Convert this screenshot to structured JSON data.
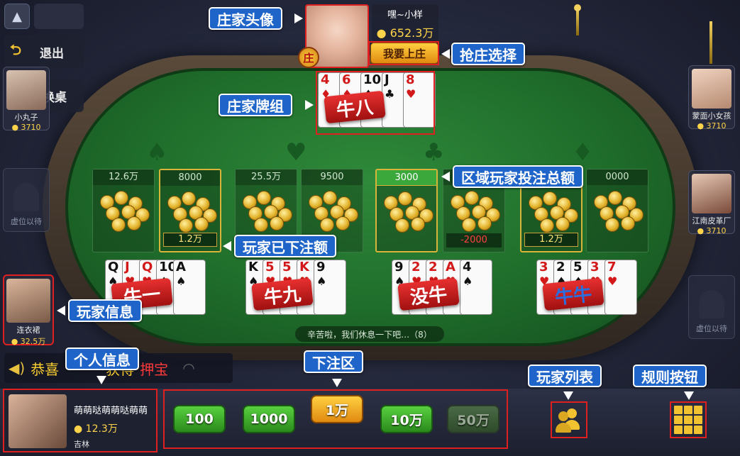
{
  "controls": {
    "collapse_icon": "triangle-up",
    "exit_label": "退出",
    "switch_label": "换桌"
  },
  "banker": {
    "name": "嘿~小样",
    "gold": "652.3万",
    "badge": "庄",
    "grab_button": "我要上庄",
    "hand": [
      {
        "rank": "4",
        "suit": "♦",
        "color": "red"
      },
      {
        "rank": "6",
        "suit": "♦",
        "color": "red"
      },
      {
        "rank": "10",
        "suit": "♠",
        "color": "blk"
      },
      {
        "rank": "J",
        "suit": "♣",
        "color": "blk"
      },
      {
        "rank": "8",
        "suit": "♥",
        "color": "red"
      }
    ],
    "result": "牛八"
  },
  "seats": {
    "left_top": {
      "name": "小丸子",
      "gold": "3710"
    },
    "left_mid": {
      "label": "虚位以待"
    },
    "left_bottom": {
      "name": "连衣裙",
      "gold": "32.5万"
    },
    "right_top": {
      "name": "蒙面小女孩",
      "gold": "3710"
    },
    "right_mid": {
      "name": "江南皮革厂",
      "gold": "3710"
    },
    "right_bottom": {
      "label": "虚位以待"
    }
  },
  "zones": [
    {
      "total": "12.6万",
      "mine": ""
    },
    {
      "total": "8000",
      "mine": "1.2万"
    },
    {
      "total": "25.5万",
      "mine": ""
    },
    {
      "total": "9500",
      "mine": ""
    },
    {
      "total": "3000",
      "mine": ""
    },
    {
      "total": "",
      "mine": "-2000"
    },
    {
      "total": "",
      "mine": "1.2万"
    },
    {
      "total": "0000",
      "mine": ""
    }
  ],
  "hands": [
    {
      "cards": [
        {
          "rank": "Q",
          "suit": "♠",
          "color": "blk"
        },
        {
          "rank": "J",
          "suit": "♥",
          "color": "red"
        },
        {
          "rank": "Q",
          "suit": "♥",
          "color": "red"
        },
        {
          "rank": "10",
          "suit": "♠",
          "color": "blk"
        },
        {
          "rank": "A",
          "suit": "♠",
          "color": "blk"
        }
      ],
      "result": "牛一"
    },
    {
      "cards": [
        {
          "rank": "K",
          "suit": "♠",
          "color": "blk"
        },
        {
          "rank": "5",
          "suit": "♥",
          "color": "red"
        },
        {
          "rank": "5",
          "suit": "♥",
          "color": "red"
        },
        {
          "rank": "K",
          "suit": "♥",
          "color": "red"
        },
        {
          "rank": "9",
          "suit": "♠",
          "color": "blk"
        }
      ],
      "result": "牛九"
    },
    {
      "cards": [
        {
          "rank": "9",
          "suit": "♠",
          "color": "blk"
        },
        {
          "rank": "2",
          "suit": "♥",
          "color": "red"
        },
        {
          "rank": "2",
          "suit": "♥",
          "color": "red"
        },
        {
          "rank": "A",
          "suit": "♥",
          "color": "red"
        },
        {
          "rank": "4",
          "suit": "♠",
          "color": "blk"
        }
      ],
      "result": "没牛"
    },
    {
      "cards": [
        {
          "rank": "3",
          "suit": "♥",
          "color": "red"
        },
        {
          "rank": "2",
          "suit": "♠",
          "color": "blk"
        },
        {
          "rank": "5",
          "suit": "♠",
          "color": "blk"
        },
        {
          "rank": "3",
          "suit": "♥",
          "color": "red"
        },
        {
          "rank": "7",
          "suit": "♥",
          "color": "red"
        }
      ],
      "result": "牛牛"
    }
  ],
  "table_message": "辛苦啦，我们休息一下吧…（8）",
  "marquee": {
    "text": "恭喜",
    "mid": "获得",
    "hot": "押宝"
  },
  "me": {
    "name": "萌萌哒萌萌哒萌萌",
    "gold": "12.3万",
    "sub": "吉林"
  },
  "chips": [
    "100",
    "1000",
    "1万",
    "10万",
    "50万"
  ],
  "callouts": {
    "banker_avatar": "庄家头像",
    "grab_banker": "抢庄选择",
    "banker_cards": "庄家牌组",
    "zone_total": "区域玩家投注总额",
    "my_bet": "玩家已下注额",
    "player_info": "玩家信息",
    "personal_info": "个人信息",
    "bet_area": "下注区",
    "player_list": "玩家列表",
    "rules_button": "规则按钮"
  },
  "colors": {
    "felt": "#1f6d2b",
    "callout": "#1f64c8",
    "highlight": "#e02020",
    "gold": "#ffd44a"
  }
}
